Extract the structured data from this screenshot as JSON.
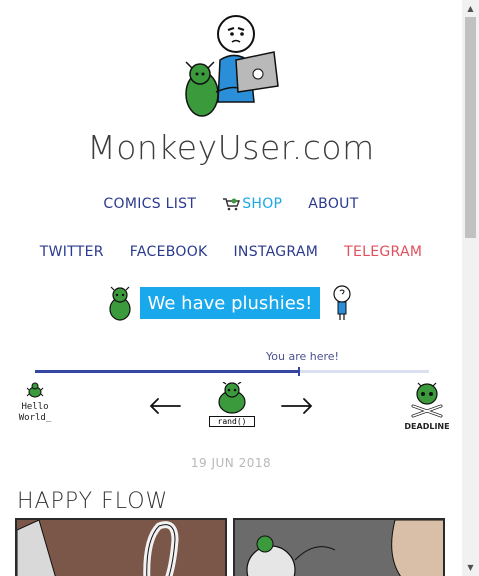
{
  "site": {
    "title": "MonkeyUser.com"
  },
  "nav_main": {
    "comics_list": "COMICS LIST",
    "shop": "SHOP",
    "about": "ABOUT"
  },
  "nav_social": {
    "twitter": "TWITTER",
    "facebook": "FACEBOOK",
    "instagram": "INSTAGRAM",
    "telegram": "TELEGRAM"
  },
  "plushies_banner": "We have plushies!",
  "progress": {
    "label": "You are here!",
    "fraction": 0.67
  },
  "navigation": {
    "first_label_line1": "Hello",
    "first_label_line2": "World_",
    "random_label": "rand()",
    "last_label": "DEADLINE"
  },
  "post": {
    "date": "19 JUN 2018",
    "title": "HAPPY FLOW"
  },
  "colors": {
    "nav_link": "#2b3a8e",
    "shop_link": "#1ba8e9",
    "telegram_link": "#e0505d",
    "banner_bg": "#19a8eb",
    "progress_fill": "#3547a3",
    "progress_track": "#dbe0f1",
    "date_text": "#b8b8b8"
  },
  "icons": {
    "shop": "shopping-cart-icon",
    "prev": "arrow-left-icon",
    "next": "arrow-right-icon"
  }
}
